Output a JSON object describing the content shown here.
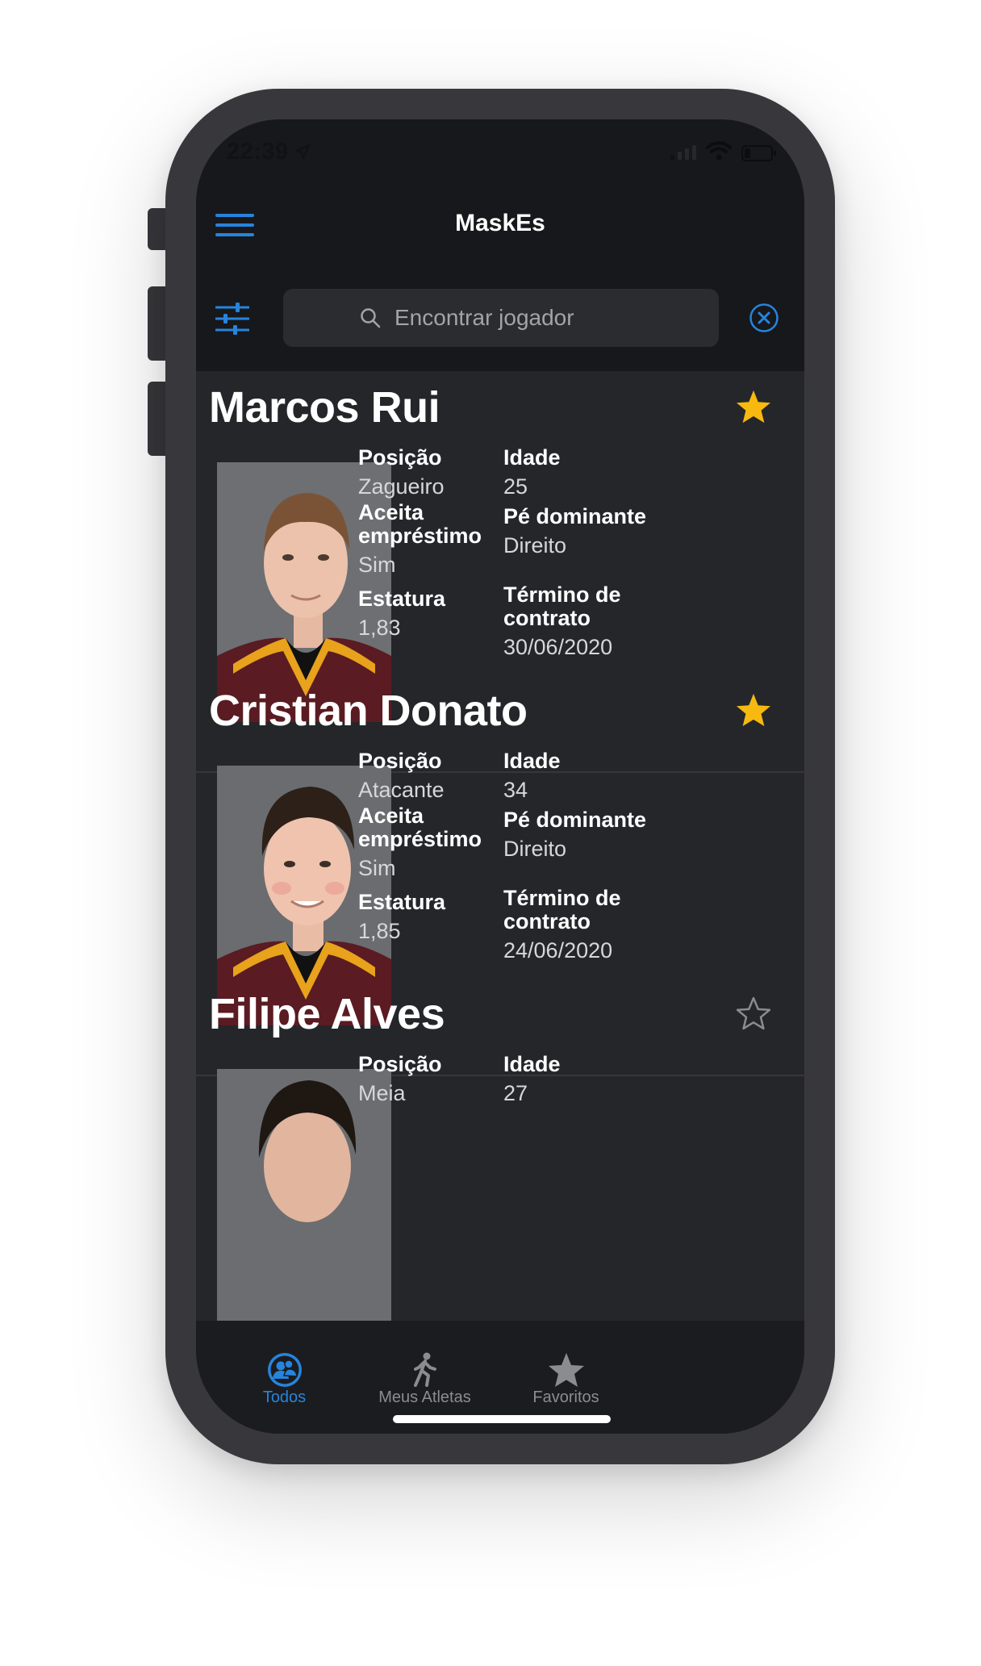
{
  "status_bar": {
    "time": "22:39"
  },
  "header": {
    "title": "MaskEs"
  },
  "search": {
    "placeholder": "Encontrar jogador"
  },
  "players": [
    {
      "name": "Marcos Rui",
      "favorite": true,
      "position_label": "Posição",
      "position": "Zagueiro",
      "age_label": "Idade",
      "age": "25",
      "loan_label": "Aceita\nempréstimo",
      "loan": "Sim",
      "foot_label": "Pé dominante",
      "foot": "Direito",
      "height_label": "Estatura",
      "height": "1,83",
      "contract_label": "Término de\ncontrato",
      "contract": "30/06/2020"
    },
    {
      "name": "Cristian Donato",
      "favorite": true,
      "position_label": "Posição",
      "position": "Atacante",
      "age_label": "Idade",
      "age": "34",
      "loan_label": "Aceita\nempréstimo",
      "loan": "Sim",
      "foot_label": "Pé dominante",
      "foot": "Direito",
      "height_label": "Estatura",
      "height": "1,85",
      "contract_label": "Término de\ncontrato",
      "contract": "24/06/2020"
    },
    {
      "name": "Filipe Alves",
      "favorite": false,
      "position_label": "Posição",
      "position": "Meia",
      "age_label": "Idade",
      "age": "27"
    }
  ],
  "tabs": [
    {
      "label": "Todos",
      "icon": "users-icon",
      "active": true
    },
    {
      "label": "Meus Atletas",
      "icon": "walking-person-icon",
      "active": false
    },
    {
      "label": "Favoritos",
      "icon": "star-icon",
      "active": false
    }
  ],
  "colors": {
    "accent": "#2684dd",
    "star": "#f7b90f",
    "background": "#24262a",
    "inactive": "#8a8c90"
  }
}
